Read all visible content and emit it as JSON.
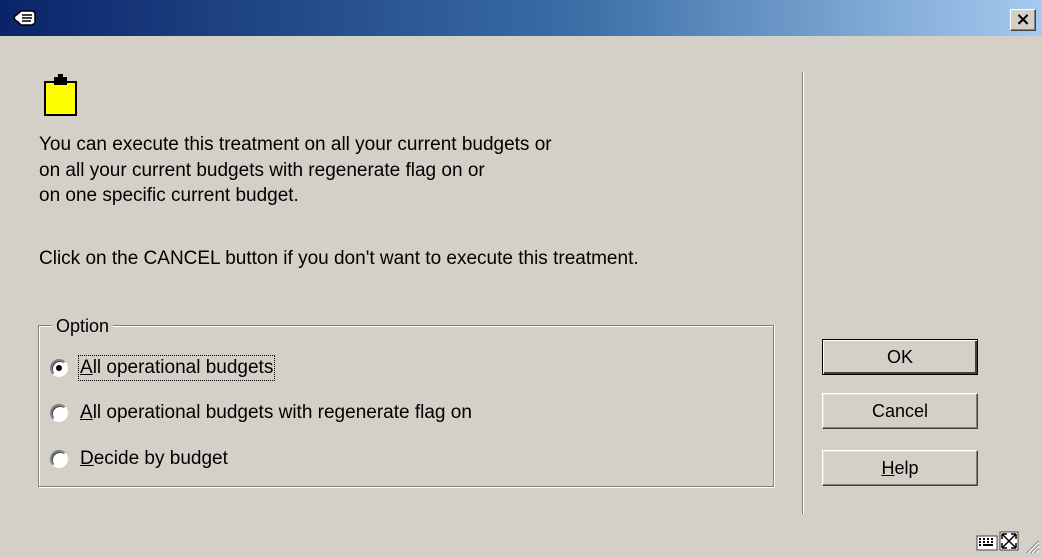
{
  "window": {
    "title_icon": "hand-pointer-icon",
    "close_label": "×"
  },
  "content": {
    "note_icon": "clipboard-icon",
    "message_lines": [
      "You can execute this treatment on all your current budgets or",
      "on all your current budgets with regenerate flag on or",
      "on one specific current budget."
    ],
    "cancel_hint": "Click on the CANCEL button if you don't want to execute this treatment."
  },
  "option_group": {
    "legend": "Option",
    "selected_index": 0,
    "options": [
      {
        "mnemonic": "A",
        "rest": "ll operational budgets"
      },
      {
        "mnemonic": "A",
        "rest": "ll operational budgets with regenerate flag on"
      },
      {
        "mnemonic": "D",
        "rest": "ecide by budget"
      }
    ]
  },
  "buttons": {
    "ok": "OK",
    "cancel": "Cancel",
    "help_mnemonic": "H",
    "help_rest": "elp"
  },
  "status_bar": {
    "icons": [
      "keyboard-icon",
      "maximize-icon",
      "resize-grip-icon"
    ]
  },
  "colors": {
    "dialog_bg": "#d4d0c8",
    "title_start": "#0a246a",
    "title_end": "#a6caf0",
    "clipboard_yellow": "#ffff00"
  }
}
